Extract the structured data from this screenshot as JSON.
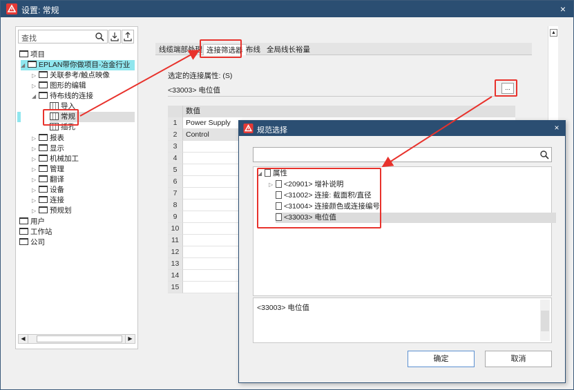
{
  "main_window": {
    "title": "设置: 常规",
    "close_label": "×"
  },
  "left_panel": {
    "search_label": "查找",
    "tree": [
      {
        "label": "项目"
      },
      {
        "label": "EPLAN带你做项目-冶金行业"
      },
      {
        "label": "关联参考/触点映像"
      },
      {
        "label": "图形的编辑"
      },
      {
        "label": "待布线的连接"
      },
      {
        "label": "导入"
      },
      {
        "label": "常规"
      },
      {
        "label": "插孔"
      },
      {
        "label": "报表"
      },
      {
        "label": "显示"
      },
      {
        "label": "机械加工"
      },
      {
        "label": "管理"
      },
      {
        "label": "翻译"
      },
      {
        "label": "设备"
      },
      {
        "label": "连接"
      },
      {
        "label": "预规划"
      },
      {
        "label": "用户"
      },
      {
        "label": "工作站"
      },
      {
        "label": "公司"
      }
    ]
  },
  "tabs": [
    {
      "label": "线缆端部处理"
    },
    {
      "label": "连接筛选器"
    },
    {
      "label": "布线"
    },
    {
      "label": "全局线长裕量"
    }
  ],
  "filter": {
    "property_label": "选定的连接属性: (S)",
    "property_value": "<33003> 电位值",
    "ellipsis_label": "..."
  },
  "grid": {
    "header": "数值",
    "rows": [
      {
        "idx": "1",
        "value": "Power Supply"
      },
      {
        "idx": "2",
        "value": "Control"
      },
      {
        "idx": "3",
        "value": ""
      },
      {
        "idx": "4",
        "value": ""
      },
      {
        "idx": "5",
        "value": ""
      },
      {
        "idx": "6",
        "value": ""
      },
      {
        "idx": "7",
        "value": ""
      },
      {
        "idx": "8",
        "value": ""
      },
      {
        "idx": "9",
        "value": ""
      },
      {
        "idx": "10",
        "value": ""
      },
      {
        "idx": "11",
        "value": ""
      },
      {
        "idx": "12",
        "value": ""
      },
      {
        "idx": "13",
        "value": ""
      },
      {
        "idx": "14",
        "value": ""
      },
      {
        "idx": "15",
        "value": ""
      }
    ]
  },
  "dialog": {
    "title": "规范选择",
    "close_label": "×",
    "tree": {
      "root": "属性",
      "items": [
        {
          "label": "<20901> 增补说明"
        },
        {
          "label": "<31002> 连接: 截面积/直径"
        },
        {
          "label": "<31004> 连接颜色或连接编号"
        },
        {
          "label": "<33003> 电位值"
        }
      ]
    },
    "description": "<33003> 电位值",
    "ok_label": "确定",
    "cancel_label": "取消"
  },
  "colors": {
    "titlebar": "#2b4e72",
    "highlight": "#e8322c",
    "tree_selected": "#8fe6ee"
  }
}
